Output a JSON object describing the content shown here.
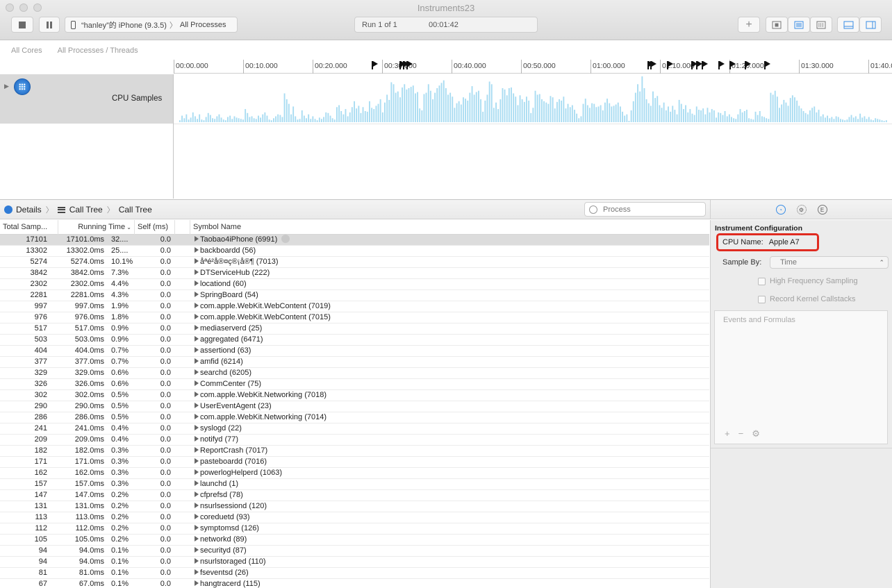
{
  "window": {
    "title": "Instruments23"
  },
  "toolbar": {
    "device": "“hanley”的 iPhone (9.3.5)",
    "target": "All Processes",
    "run": "Run 1 of 1",
    "elapsed": "00:01:42",
    "add_label": "+"
  },
  "strategy": {
    "cores": "All Cores",
    "threads": "All Processes / Threads"
  },
  "ruler": {
    "ticks": [
      "00:00.000",
      "00:10.000",
      "00:20.000",
      "00:30.000",
      "00:40.000",
      "00:50.000",
      "01:00.000",
      "01:10.000",
      "01:20.000",
      "01:30.000",
      "01:40.000"
    ]
  },
  "track": {
    "label": "CPU Samples",
    "bar_color": "#a9dcf2",
    "samples": [
      3,
      10,
      6,
      12,
      4,
      7,
      15,
      9,
      5,
      12,
      4,
      3,
      8,
      14,
      11,
      6,
      5,
      9,
      12,
      7,
      4,
      3,
      8,
      10,
      5,
      9,
      7,
      6,
      5,
      4,
      20,
      14,
      8,
      9,
      6,
      5,
      10,
      7,
      12,
      15,
      10,
      4,
      3,
      6,
      9,
      12,
      11,
      8,
      44,
      35,
      28,
      12,
      24,
      9,
      4,
      5,
      18,
      10,
      6,
      12,
      5,
      9,
      5,
      3,
      7,
      5,
      8,
      15,
      14,
      10,
      6,
      4,
      23,
      26,
      17,
      12,
      20,
      9,
      15,
      23,
      32,
      21,
      25,
      14,
      23,
      17,
      16,
      32,
      22,
      20,
      25,
      28,
      35,
      15,
      30,
      42,
      34,
      61,
      58,
      45,
      47,
      38,
      53,
      58,
      50,
      52,
      54,
      56,
      44,
      46,
      21,
      18,
      43,
      45,
      58,
      48,
      35,
      45,
      52,
      56,
      60,
      64,
      52,
      42,
      45,
      39,
      22,
      29,
      32,
      27,
      38,
      36,
      33,
      45,
      55,
      42,
      46,
      48,
      35,
      16,
      33,
      42,
      62,
      58,
      22,
      30,
      20,
      35,
      52,
      50,
      41,
      52,
      53,
      44,
      39,
      26,
      41,
      35,
      31,
      39,
      33,
      14,
      22,
      48,
      42,
      43,
      35,
      32,
      30,
      28,
      40,
      38,
      21,
      31,
      35,
      33,
      39,
      21,
      28,
      23,
      26,
      19,
      13,
      6,
      9,
      28,
      36,
      26,
      22,
      29,
      28,
      23,
      24,
      26,
      18,
      30,
      36,
      29,
      24,
      25,
      27,
      30,
      24,
      16,
      10,
      12,
      2,
      18,
      32,
      45,
      58,
      47,
      70,
      52,
      35,
      29,
      25,
      47,
      37,
      40,
      26,
      22,
      30,
      18,
      24,
      16,
      25,
      19,
      12,
      34,
      28,
      20,
      26,
      15,
      20,
      13,
      11,
      24,
      19,
      18,
      21,
      12,
      22,
      15,
      20,
      18,
      7,
      15,
      14,
      11,
      17,
      9,
      12,
      8,
      6,
      5,
      12,
      20,
      15,
      17,
      19,
      6,
      5,
      4,
      16,
      11,
      17,
      9,
      8,
      6,
      5,
      45,
      42,
      48,
      39,
      22,
      27,
      34,
      30,
      25,
      37,
      41,
      38,
      33,
      25,
      21,
      17,
      14,
      12,
      18,
      22,
      24,
      15,
      19,
      9,
      12,
      7,
      10,
      6,
      8,
      5,
      9,
      8,
      5,
      4,
      3,
      4,
      8,
      11,
      7,
      9,
      5,
      13,
      7,
      9,
      5,
      8,
      4,
      3,
      6,
      5,
      4,
      3,
      2,
      3
    ],
    "flags": [
      285,
      325,
      330,
      335,
      682,
      686,
      710,
      745,
      752,
      760,
      784,
      800,
      822,
      850
    ]
  },
  "details": {
    "crumbs": [
      "Details",
      "Call Tree",
      "Call Tree"
    ],
    "search_placeholder": "Process"
  },
  "table": {
    "headers": [
      "Total Samp...",
      "Running Time",
      "Self (ms)",
      "Symbol Name"
    ],
    "rows": [
      [
        "17101",
        "17101.0ms",
        "32....",
        "0.0",
        "Taobao4iPhone (6991)"
      ],
      [
        "13302",
        "13302.0ms",
        "25....",
        "0.0",
        "backboardd (56)"
      ],
      [
        "5274",
        "5274.0ms",
        "10.1%",
        "0.0",
        "åªé²å®¤ç®¡å®¶ (7013)"
      ],
      [
        "3842",
        "3842.0ms",
        "7.3%",
        "0.0",
        "DTServiceHub (222)"
      ],
      [
        "2302",
        "2302.0ms",
        "4.4%",
        "0.0",
        "locationd (60)"
      ],
      [
        "2281",
        "2281.0ms",
        "4.3%",
        "0.0",
        "SpringBoard (54)"
      ],
      [
        "997",
        "997.0ms",
        "1.9%",
        "0.0",
        "com.apple.WebKit.WebContent (7019)"
      ],
      [
        "976",
        "976.0ms",
        "1.8%",
        "0.0",
        "com.apple.WebKit.WebContent (7015)"
      ],
      [
        "517",
        "517.0ms",
        "0.9%",
        "0.0",
        "mediaserverd (25)"
      ],
      [
        "503",
        "503.0ms",
        "0.9%",
        "0.0",
        "aggregated (6471)"
      ],
      [
        "404",
        "404.0ms",
        "0.7%",
        "0.0",
        "assertiond (63)"
      ],
      [
        "377",
        "377.0ms",
        "0.7%",
        "0.0",
        "amfid (6214)"
      ],
      [
        "329",
        "329.0ms",
        "0.6%",
        "0.0",
        "searchd (6205)"
      ],
      [
        "326",
        "326.0ms",
        "0.6%",
        "0.0",
        "CommCenter (75)"
      ],
      [
        "302",
        "302.0ms",
        "0.5%",
        "0.0",
        "com.apple.WebKit.Networking (7018)"
      ],
      [
        "290",
        "290.0ms",
        "0.5%",
        "0.0",
        "UserEventAgent (23)"
      ],
      [
        "286",
        "286.0ms",
        "0.5%",
        "0.0",
        "com.apple.WebKit.Networking (7014)"
      ],
      [
        "241",
        "241.0ms",
        "0.4%",
        "0.0",
        "syslogd (22)"
      ],
      [
        "209",
        "209.0ms",
        "0.4%",
        "0.0",
        "notifyd (77)"
      ],
      [
        "182",
        "182.0ms",
        "0.3%",
        "0.0",
        "ReportCrash (7017)"
      ],
      [
        "171",
        "171.0ms",
        "0.3%",
        "0.0",
        "pasteboardd (7016)"
      ],
      [
        "162",
        "162.0ms",
        "0.3%",
        "0.0",
        "powerlogHelperd (1063)"
      ],
      [
        "157",
        "157.0ms",
        "0.3%",
        "0.0",
        "launchd (1)"
      ],
      [
        "147",
        "147.0ms",
        "0.2%",
        "0.0",
        "cfprefsd (78)"
      ],
      [
        "131",
        "131.0ms",
        "0.2%",
        "0.0",
        "nsurlsessiond (120)"
      ],
      [
        "113",
        "113.0ms",
        "0.2%",
        "0.0",
        "coreduetd (93)"
      ],
      [
        "112",
        "112.0ms",
        "0.2%",
        "0.0",
        "symptomsd (126)"
      ],
      [
        "105",
        "105.0ms",
        "0.2%",
        "0.0",
        "networkd (89)"
      ],
      [
        "94",
        "94.0ms",
        "0.1%",
        "0.0",
        "securityd (87)"
      ],
      [
        "94",
        "94.0ms",
        "0.1%",
        "0.0",
        "nsurlstoraged (110)"
      ],
      [
        "81",
        "81.0ms",
        "0.1%",
        "0.0",
        "fseventsd (26)"
      ],
      [
        "67",
        "67.0ms",
        "0.1%",
        "0.0",
        "hangtracerd (115)"
      ]
    ]
  },
  "inspector": {
    "title": "Instrument Configuration",
    "cpu_name_label": "CPU Name:",
    "cpu_name_value": "Apple A7",
    "sample_by_label": "Sample By:",
    "sample_by_value": "Time",
    "high_freq": "High Frequency Sampling",
    "kernel_callstacks": "Record Kernel Callstacks",
    "events_placeholder": "Events and Formulas",
    "highlight_color": "#e02b20"
  }
}
